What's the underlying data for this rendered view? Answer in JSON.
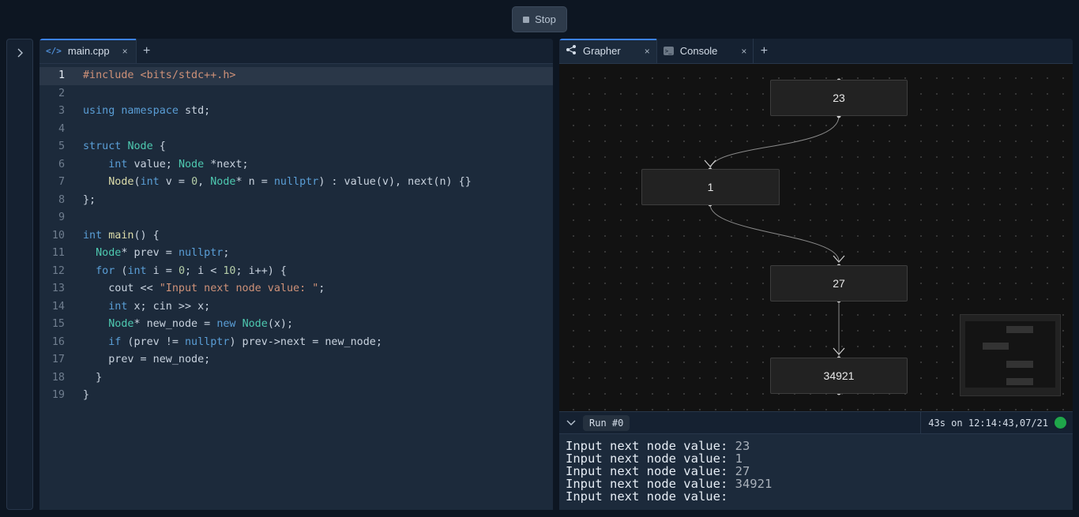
{
  "toolbar": {
    "stop_label": "Stop"
  },
  "editor": {
    "tab_label": "main.cpp",
    "tab_icon": "code-icon",
    "close_glyph": "×",
    "add_glyph": "+",
    "current_line": 1,
    "lines": [
      "1",
      "2",
      "3",
      "4",
      "5",
      "6",
      "7",
      "8",
      "9",
      "10",
      "11",
      "12",
      "13",
      "14",
      "15",
      "16",
      "17",
      "18",
      "19"
    ],
    "code_lines": [
      [
        {
          "t": "pp",
          "v": "#include <bits/stdc++.h>"
        }
      ],
      [],
      [
        {
          "t": "kw",
          "v": "using"
        },
        {
          "t": "var",
          "v": " "
        },
        {
          "t": "kw",
          "v": "namespace"
        },
        {
          "t": "var",
          "v": " std;"
        }
      ],
      [],
      [
        {
          "t": "kw",
          "v": "struct"
        },
        {
          "t": "var",
          "v": " "
        },
        {
          "t": "ty",
          "v": "Node"
        },
        {
          "t": "var",
          "v": " {"
        }
      ],
      [
        {
          "t": "var",
          "v": "    "
        },
        {
          "t": "kw",
          "v": "int"
        },
        {
          "t": "var",
          "v": " value; "
        },
        {
          "t": "ty",
          "v": "Node"
        },
        {
          "t": "var",
          "v": " *next;"
        }
      ],
      [
        {
          "t": "var",
          "v": "    "
        },
        {
          "t": "fn",
          "v": "Node"
        },
        {
          "t": "var",
          "v": "("
        },
        {
          "t": "kw",
          "v": "int"
        },
        {
          "t": "var",
          "v": " v = "
        },
        {
          "t": "num",
          "v": "0"
        },
        {
          "t": "var",
          "v": ", "
        },
        {
          "t": "ty",
          "v": "Node"
        },
        {
          "t": "var",
          "v": "* n = "
        },
        {
          "t": "kw",
          "v": "nullptr"
        },
        {
          "t": "var",
          "v": ") : value(v), next(n) {}"
        }
      ],
      [
        {
          "t": "var",
          "v": "};"
        }
      ],
      [],
      [
        {
          "t": "kw",
          "v": "int"
        },
        {
          "t": "var",
          "v": " "
        },
        {
          "t": "fn",
          "v": "main"
        },
        {
          "t": "var",
          "v": "() {"
        }
      ],
      [
        {
          "t": "var",
          "v": "  "
        },
        {
          "t": "ty",
          "v": "Node"
        },
        {
          "t": "var",
          "v": "* prev = "
        },
        {
          "t": "kw",
          "v": "nullptr"
        },
        {
          "t": "var",
          "v": ";"
        }
      ],
      [
        {
          "t": "var",
          "v": "  "
        },
        {
          "t": "kw",
          "v": "for"
        },
        {
          "t": "var",
          "v": " ("
        },
        {
          "t": "kw",
          "v": "int"
        },
        {
          "t": "var",
          "v": " i = "
        },
        {
          "t": "num",
          "v": "0"
        },
        {
          "t": "var",
          "v": "; i < "
        },
        {
          "t": "num",
          "v": "10"
        },
        {
          "t": "var",
          "v": "; i++) {"
        }
      ],
      [
        {
          "t": "var",
          "v": "    cout << "
        },
        {
          "t": "str",
          "v": "\"Input next node value: \""
        },
        {
          "t": "var",
          "v": ";"
        }
      ],
      [
        {
          "t": "var",
          "v": "    "
        },
        {
          "t": "kw",
          "v": "int"
        },
        {
          "t": "var",
          "v": " x; cin >> x;"
        }
      ],
      [
        {
          "t": "var",
          "v": "    "
        },
        {
          "t": "ty",
          "v": "Node"
        },
        {
          "t": "var",
          "v": "* new_node = "
        },
        {
          "t": "kw",
          "v": "new"
        },
        {
          "t": "var",
          "v": " "
        },
        {
          "t": "ty",
          "v": "Node"
        },
        {
          "t": "var",
          "v": "(x);"
        }
      ],
      [
        {
          "t": "var",
          "v": "    "
        },
        {
          "t": "kw",
          "v": "if"
        },
        {
          "t": "var",
          "v": " (prev != "
        },
        {
          "t": "kw",
          "v": "nullptr"
        },
        {
          "t": "var",
          "v": ") prev->next = new_node;"
        }
      ],
      [
        {
          "t": "var",
          "v": "    prev = new_node;"
        }
      ],
      [
        {
          "t": "var",
          "v": "  }"
        }
      ],
      [
        {
          "t": "var",
          "v": "}"
        }
      ]
    ]
  },
  "right_panel": {
    "tabs": [
      {
        "label": "Grapher",
        "icon": "share-graph-icon",
        "active": true
      },
      {
        "label": "Console",
        "icon": "console-icon",
        "active": false
      }
    ],
    "close_glyph": "×",
    "add_glyph": "+"
  },
  "graph": {
    "nodes": [
      {
        "value": "23"
      },
      {
        "value": "1"
      },
      {
        "value": "27"
      },
      {
        "value": "34921"
      }
    ]
  },
  "output": {
    "run_label": "Run #0",
    "status": "43s on 12:14:43,07/21",
    "status_color": "#1fa64a",
    "prompt": "Input next node value: ",
    "lines": [
      {
        "value": "23"
      },
      {
        "value": "1"
      },
      {
        "value": "27"
      },
      {
        "value": "34921"
      },
      {
        "value": ""
      }
    ]
  }
}
